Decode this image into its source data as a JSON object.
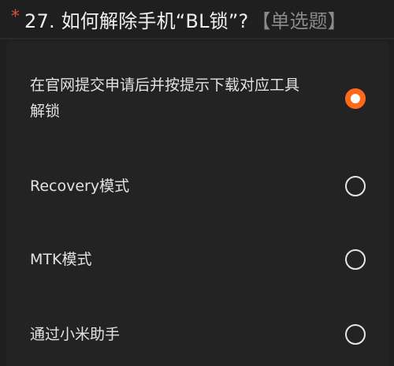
{
  "question": {
    "required_marker": "*",
    "title": "27. 如何解除手机“BL锁”?",
    "type": "【单选题】"
  },
  "options": [
    {
      "label": "在官网提交申请后并按提示下载对应工具解锁",
      "selected": true
    },
    {
      "label": "Recovery模式",
      "selected": false
    },
    {
      "label": "MTK模式",
      "selected": false
    },
    {
      "label": "通过小米助手",
      "selected": false
    }
  ],
  "colors": {
    "background": "#1f1f1f",
    "accent": "#ff6a1a",
    "required": "#e0503a",
    "muted_text": "#8a8a8a"
  }
}
